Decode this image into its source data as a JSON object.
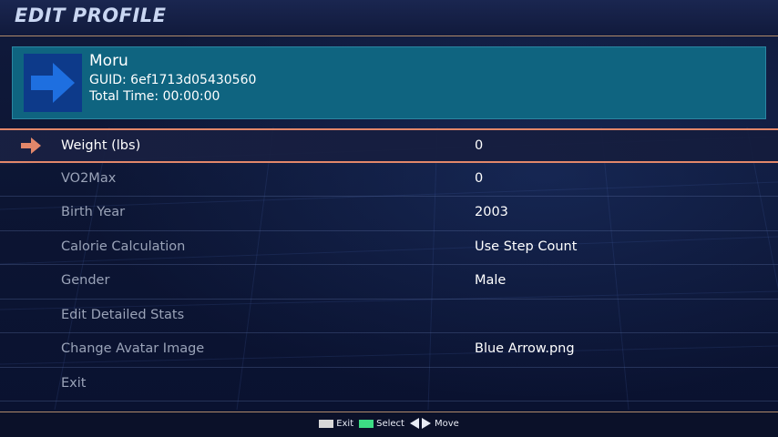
{
  "header": {
    "title": "EDIT PROFILE"
  },
  "profile": {
    "name": "Moru",
    "guid": "GUID: 6ef1713d05430560",
    "total_time": "Total Time: 00:00:00",
    "avatar_icon": "blue-arrow-icon",
    "avatar_color": "#1e6fe0"
  },
  "menu": {
    "selected_index": 0,
    "items": [
      {
        "label": "Weight (lbs)",
        "value": "0"
      },
      {
        "label": "VO2Max",
        "value": "0"
      },
      {
        "label": "Birth Year",
        "value": "2003"
      },
      {
        "label": "Calorie Calculation",
        "value": "Use Step Count"
      },
      {
        "label": "Gender",
        "value": "Male"
      },
      {
        "label": "Edit Detailed Stats",
        "value": ""
      },
      {
        "label": "Change Avatar Image",
        "value": "Blue Arrow.png"
      },
      {
        "label": "Exit",
        "value": ""
      }
    ]
  },
  "footer": {
    "exit_label": "Exit",
    "select_label": "Select",
    "move_label": "Move"
  },
  "colors": {
    "accent": "#e2876a",
    "card": "#0f6480",
    "background": "#0d1430",
    "select_key": "#3ddc84"
  }
}
